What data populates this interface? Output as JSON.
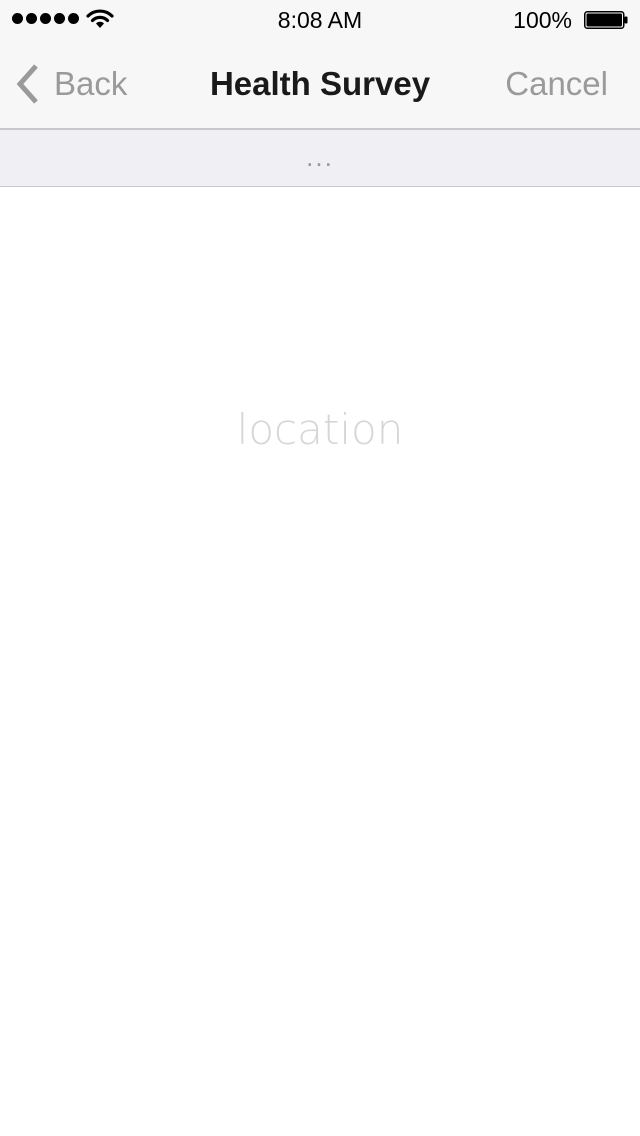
{
  "status_bar": {
    "signal_dots": 5,
    "wifi_icon": "wifi-icon",
    "time": "8:08 AM",
    "battery_percent": "100%",
    "battery_level": 1.0,
    "battery_icon": "battery-icon"
  },
  "nav_bar": {
    "back_icon": "chevron-left-icon",
    "back_label": "Back",
    "title": "Health Survey",
    "cancel_label": "Cancel"
  },
  "step_strip": {
    "text": "..."
  },
  "content": {
    "placeholder_text": "location"
  },
  "colors": {
    "bar_background": "#f7f7f7",
    "strip_background": "#efeff4",
    "secondary_text": "#9a9a9a",
    "title_text": "#1a1a1a",
    "placeholder_text": "#d6d6d6"
  }
}
